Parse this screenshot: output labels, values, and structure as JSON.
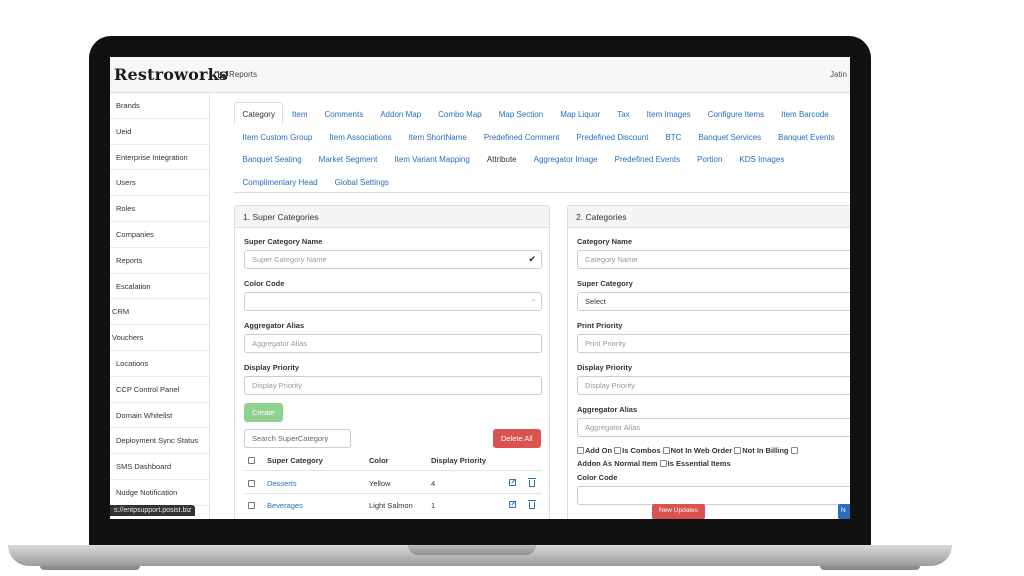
{
  "app": {
    "logo": "Restroworks",
    "nav_reports": "Reports",
    "user": "Jatin"
  },
  "sidebar": {
    "items": [
      "Brands",
      "Ueid",
      "Enterprise Integration",
      "Users",
      "Roles",
      "Companies",
      "Reports",
      "Escalation",
      "CRM",
      "Vouchers",
      "Locations",
      "CCP Control Panel",
      "Domain Whitelist",
      "Deployment Sync Status",
      "SMS Dashboard",
      "Nudge Notification"
    ]
  },
  "status_url": "s://entpsupport.posist.biz",
  "tabs": [
    "Category",
    "Item",
    "Comments",
    "Addon Map",
    "Combo Map",
    "Map Section",
    "Map Liquor",
    "Tax",
    "Item Images",
    "Configure Items",
    "Item Barcode",
    "Item Custom Group",
    "Item Associations",
    "Item ShortName",
    "Predefined Comment",
    "Predefined Discount",
    "BTC",
    "Banquet Services",
    "Banquet Events",
    "Banquet Seating",
    "Market Segment",
    "Item Variant Mapping",
    "Attribute",
    "Aggregator Image",
    "Predefined Events",
    "Portion",
    "KDS Images",
    "Complimentary Head",
    "Global Settings"
  ],
  "super_categories": {
    "title": "1. Super Categories",
    "name_label": "Super Category Name",
    "name_placeholder": "Super Category Name",
    "color_label": "Color Code",
    "alias_label": "Aggregator Alias",
    "alias_placeholder": "Aggregator Alias",
    "priority_label": "Display Priority",
    "priority_placeholder": "Display Priority",
    "create_button": "Create",
    "search_placeholder": "Search SuperCategory",
    "delete_all_button": "Delete All",
    "table": {
      "headers": [
        "Super Category",
        "Color",
        "Display Priority"
      ],
      "rows": [
        {
          "name": "Desserts",
          "color": "Yellow",
          "priority": "4"
        },
        {
          "name": "Beverages",
          "color": "Light Salmon",
          "priority": "1"
        }
      ]
    }
  },
  "categories": {
    "title": "2. Categories",
    "name_label": "Category Name",
    "name_placeholder": "Category Name",
    "super_label": "Super Category",
    "super_value": "Select",
    "print_label": "Print Priority",
    "print_placeholder": "Print Priority",
    "display_label": "Display Priority",
    "display_placeholder": "Display Priority",
    "alias_label": "Aggregator Alias",
    "alias_placeholder": "Aggregator Alias",
    "flags_line1": [
      "Add On",
      "Is Combos",
      "Not In Web Order",
      "Not In Billing"
    ],
    "flags_line2_a": "Addon As Normal Item",
    "flags_line2_b": "Is Essential Items",
    "color_label": "Color Code"
  },
  "new_updates": "New Updates",
  "blue_tab": "N"
}
